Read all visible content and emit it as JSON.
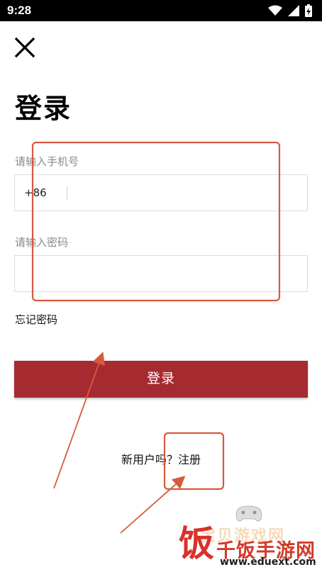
{
  "status_bar": {
    "time": "9:28",
    "icons": [
      "wifi-icon",
      "signal-icon",
      "battery-charging-icon"
    ]
  },
  "header": {
    "close_icon": "close-icon",
    "title": "登录"
  },
  "form": {
    "phone_label": "请输入手机号",
    "country_code": "+86",
    "phone_value": "",
    "password_label": "请输入密码",
    "password_value": "",
    "forgot_password": "忘记密码",
    "login_button": "登录"
  },
  "footer": {
    "register_prompt": "新用户吗？",
    "register_link": "注册"
  },
  "watermark": {
    "site_name": "宝贝游戏网",
    "brand_char": "饭",
    "brand": "千饭手游网",
    "url": "www.eduext.com"
  },
  "colors": {
    "accent": "#a62b30",
    "annotation": "#d65a3c",
    "label_gray": "#8a8a8a"
  }
}
